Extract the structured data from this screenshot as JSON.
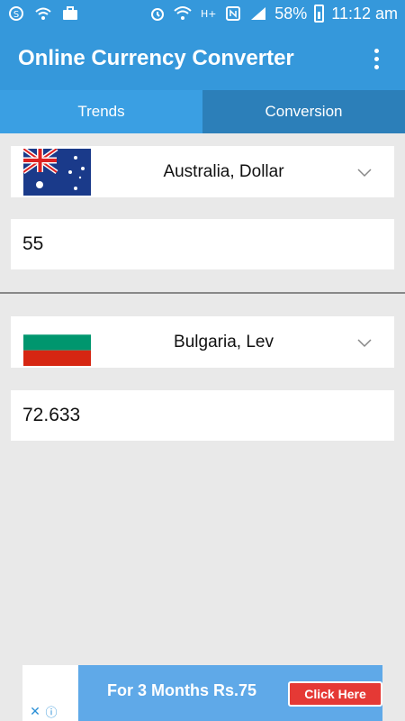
{
  "status_bar": {
    "battery": "58%",
    "time": "11:12 am"
  },
  "app_bar": {
    "title": "Online Currency Converter"
  },
  "tabs": [
    {
      "label": "Trends"
    },
    {
      "label": "Conversion"
    }
  ],
  "from_currency": {
    "label": "Australia, Dollar",
    "amount": "55"
  },
  "to_currency": {
    "label": "Bulgaria, Lev",
    "amount": "72.633"
  },
  "ad": {
    "cta": "Click Here",
    "promo": "For 3 Months Rs.75"
  },
  "colors": {
    "primary": "#3598db",
    "tab_active": "#3a9fe3",
    "tab_inactive": "#2c7fb9",
    "background": "#e9e9e9"
  }
}
